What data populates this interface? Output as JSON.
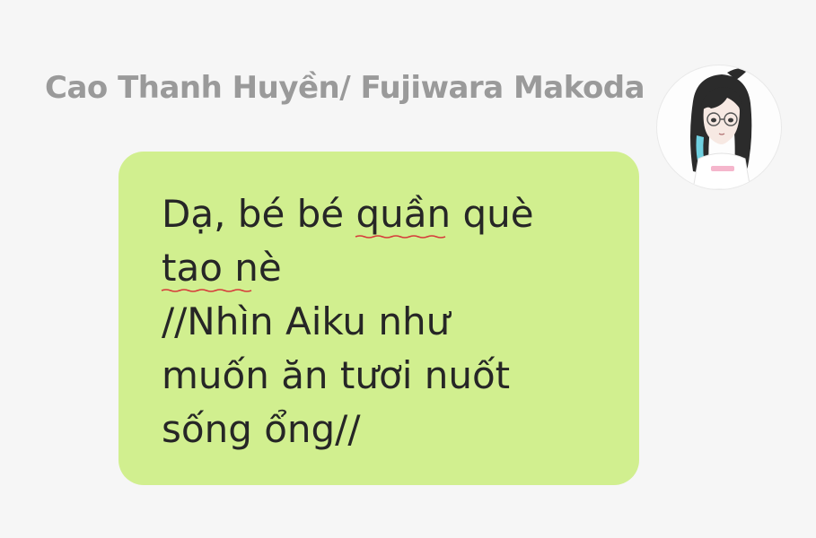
{
  "sender": {
    "name": "Cao Thanh Huyền/ Fujiwara Makoda"
  },
  "avatar": {
    "icon": "anime-girl-avatar-icon"
  },
  "message": {
    "line1_prefix": "Dạ, bé bé ",
    "line1_marked": "quần què",
    "line2_marked": "tao nè",
    "line3": "//Nhìn Aiku như",
    "line4": "muốn ăn tươi nuốt",
    "line5": "sống ổng//",
    "bubble_color": "#d1ef8f",
    "spellcheck_color": "#d63a3a"
  }
}
